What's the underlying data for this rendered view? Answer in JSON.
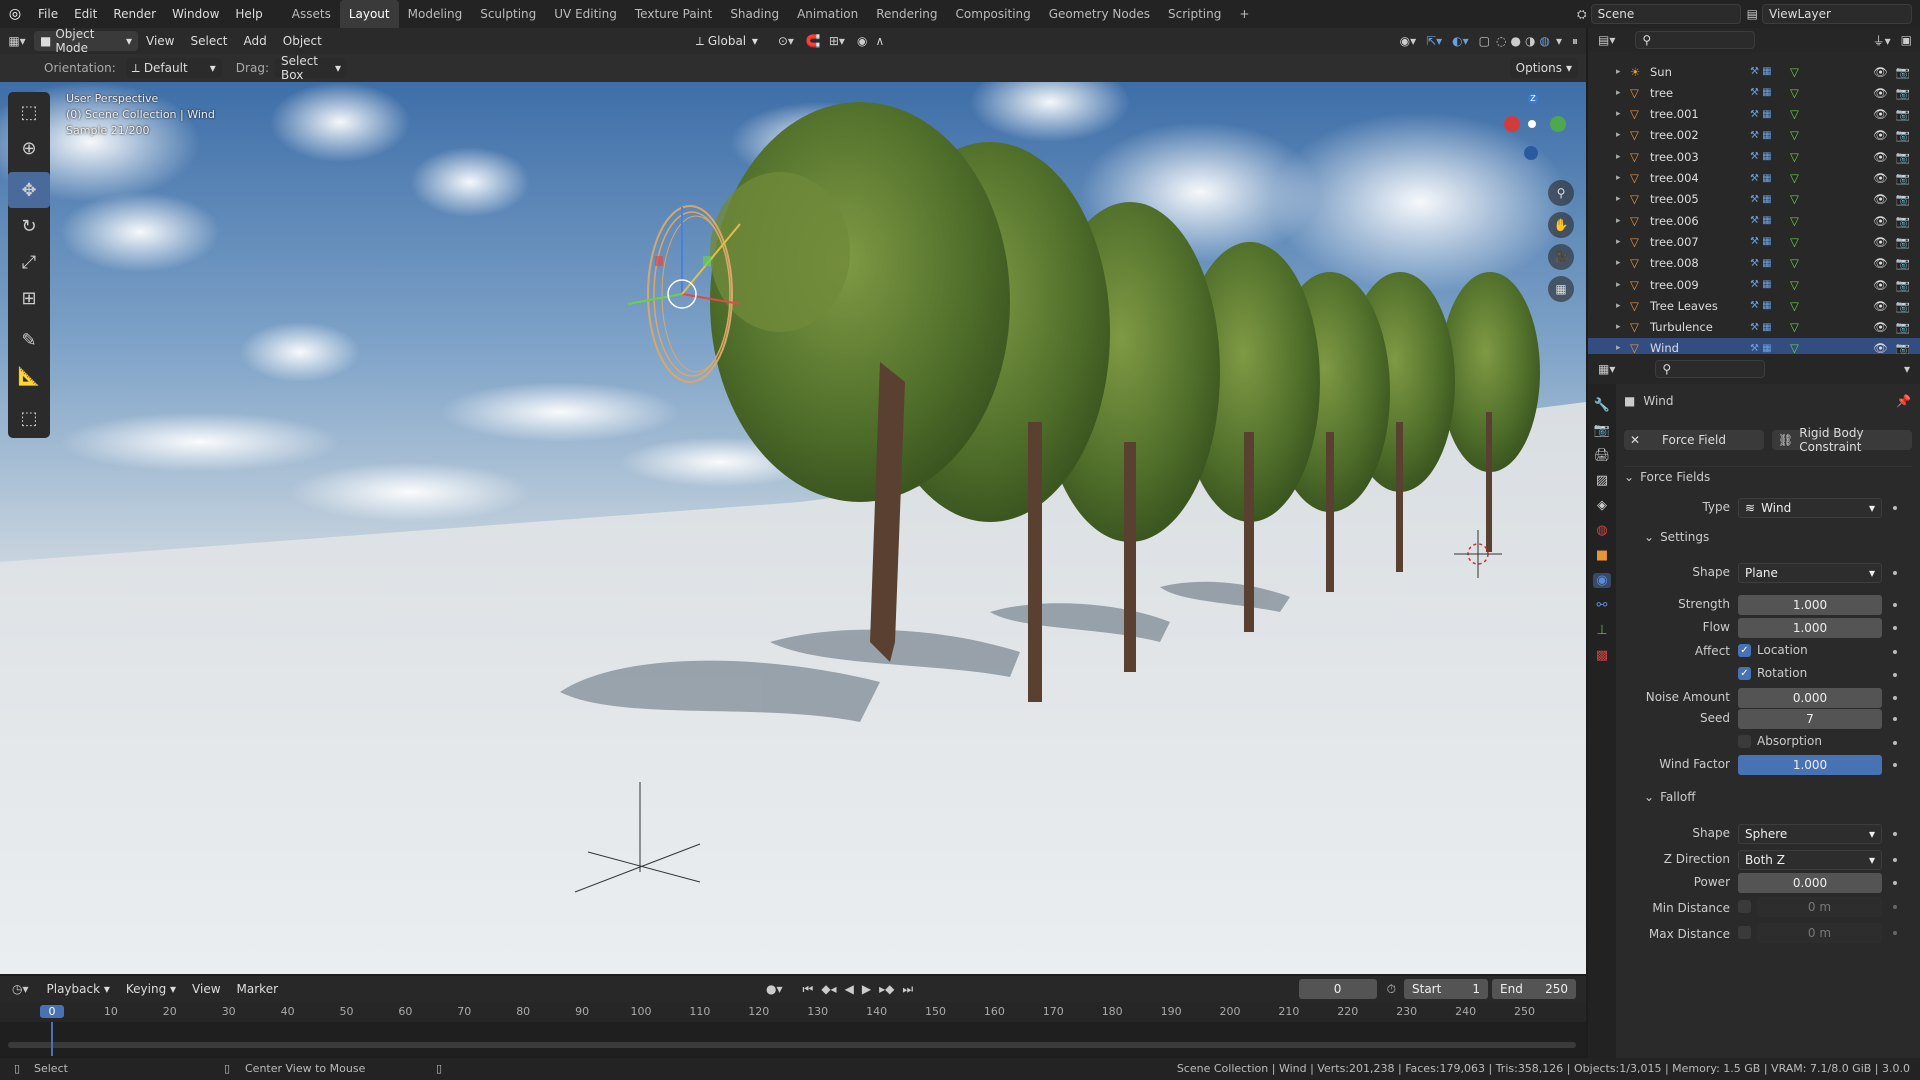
{
  "menu": {
    "items": [
      "File",
      "Edit",
      "Render",
      "Window",
      "Help"
    ]
  },
  "workspaces": {
    "tabs": [
      "Assets",
      "Layout",
      "Modeling",
      "Sculpting",
      "UV Editing",
      "Texture Paint",
      "Shading",
      "Animation",
      "Rendering",
      "Compositing",
      "Geometry Nodes",
      "Scripting"
    ],
    "active": "Layout",
    "add": "+"
  },
  "scene": {
    "name": "Scene",
    "view_layer": "ViewLayer"
  },
  "header": {
    "mode": "Object Mode",
    "view": "View",
    "select": "Select",
    "add": "Add",
    "object": "Object",
    "transform": "Global"
  },
  "tool_settings": {
    "orientation_label": "Orientation:",
    "orientation": "Default",
    "drag_label": "Drag:",
    "drag": "Select Box",
    "options": "Options"
  },
  "viewport": {
    "line1": "User Perspective",
    "line2": "(0) Scene Collection | Wind",
    "line3": "Sample 21/200",
    "axis_z": "Z"
  },
  "outliner": {
    "items": [
      {
        "name": "Sun",
        "selected": false
      },
      {
        "name": "tree",
        "selected": false
      },
      {
        "name": "tree.001",
        "selected": false
      },
      {
        "name": "tree.002",
        "selected": false
      },
      {
        "name": "tree.003",
        "selected": false
      },
      {
        "name": "tree.004",
        "selected": false
      },
      {
        "name": "tree.005",
        "selected": false
      },
      {
        "name": "tree.006",
        "selected": false
      },
      {
        "name": "tree.007",
        "selected": false
      },
      {
        "name": "tree.008",
        "selected": false
      },
      {
        "name": "tree.009",
        "selected": false
      },
      {
        "name": "Tree Leaves",
        "selected": false
      },
      {
        "name": "Turbulence",
        "selected": false
      },
      {
        "name": "Wind",
        "selected": true
      }
    ]
  },
  "properties": {
    "object_name": "Wind",
    "force_field_btn": "Force Field",
    "rigid_body_btn": "Rigid Body Constraint",
    "force_fields_panel": "Force Fields",
    "type_label": "Type",
    "type_value": "Wind",
    "settings_panel": "Settings",
    "shape_label": "Shape",
    "shape_value": "Plane",
    "strength_label": "Strength",
    "strength_value": "1.000",
    "flow_label": "Flow",
    "flow_value": "1.000",
    "affect_label": "Affect",
    "location_label": "Location",
    "rotation_label": "Rotation",
    "noise_label": "Noise Amount",
    "noise_value": "0.000",
    "seed_label": "Seed",
    "seed_value": "7",
    "absorption_label": "Absorption",
    "wind_factor_label": "Wind Factor",
    "wind_factor_value": "1.000",
    "falloff_panel": "Falloff",
    "falloff_shape_label": "Shape",
    "falloff_shape_value": "Sphere",
    "zdir_label": "Z Direction",
    "zdir_value": "Both Z",
    "power_label": "Power",
    "power_value": "0.000",
    "min_dist_label": "Min Distance",
    "min_dist_value": "0 m",
    "max_dist_label": "Max Distance",
    "max_dist_value": "0 m"
  },
  "timeline": {
    "playback": "Playback",
    "keying": "Keying",
    "view": "View",
    "marker": "Marker",
    "current_frame": "0",
    "start_label": "Start",
    "start": "1",
    "end_label": "End",
    "end": "250",
    "ticks": [
      "0",
      "10",
      "20",
      "30",
      "40",
      "50",
      "60",
      "70",
      "80",
      "90",
      "100",
      "110",
      "120",
      "130",
      "140",
      "150",
      "160",
      "170",
      "180",
      "190",
      "200",
      "210",
      "220",
      "230",
      "240",
      "250"
    ]
  },
  "status": {
    "select": "Select",
    "center_view": "Center View to Mouse",
    "info": "Scene Collection | Wind | Verts:201,238 | Faces:179,063 | Tris:358,126 | Objects:1/3,015 | Memory: 1.5 GB | VRAM: 7.1/8.0 GiB | 3.0.0"
  }
}
